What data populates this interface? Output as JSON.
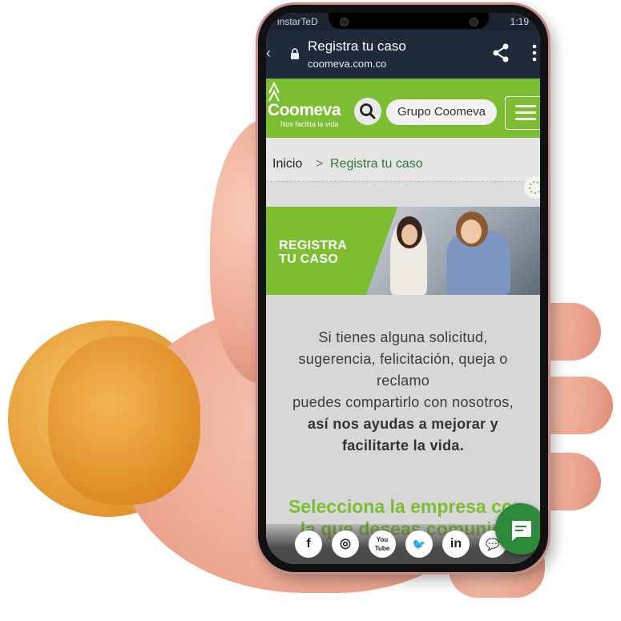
{
  "statusbar": {
    "left": "instarTeD",
    "right": "1:19"
  },
  "browser": {
    "title": "Registra tu caso",
    "host": "coomeva.com.co"
  },
  "header": {
    "logo_text": "Coomeva",
    "logo_tagline": "Nos facilita la vida",
    "grupo_button": "Grupo Coomeva"
  },
  "breadcrumb": {
    "home": "Inicio",
    "separator": ">",
    "current": "Registra tu caso"
  },
  "banner": {
    "title_line1": "REGISTRA",
    "title_line2": "TU CASO"
  },
  "intro": {
    "line1": "Si tienes alguna solicitud,",
    "line2": "sugerencia, felicitación, queja o",
    "line3": "reclamo",
    "line4": "puedes compartirlo con nosotros,",
    "line5": "así nos ayudas a mejorar y",
    "line6": "facilitarte la vida."
  },
  "select_company": {
    "line1": "Selecciona la empresa con",
    "line2": "la que deseas comunica"
  },
  "social": [
    {
      "icon": "facebook-icon",
      "label": "f"
    },
    {
      "icon": "instagram-icon",
      "label": "◎"
    },
    {
      "icon": "youtube-icon",
      "label": "You Tube"
    },
    {
      "icon": "twitter-icon",
      "label": "🐦"
    },
    {
      "icon": "linkedin-icon",
      "label": "in"
    },
    {
      "icon": "chat-bubble-icon",
      "label": "💬"
    }
  ],
  "colors": {
    "brand_green": "#7cbd32",
    "dark_green": "#2e8a3b",
    "browser_bar": "#1f2a3a",
    "breadcrumb_link": "#2f7a34"
  }
}
